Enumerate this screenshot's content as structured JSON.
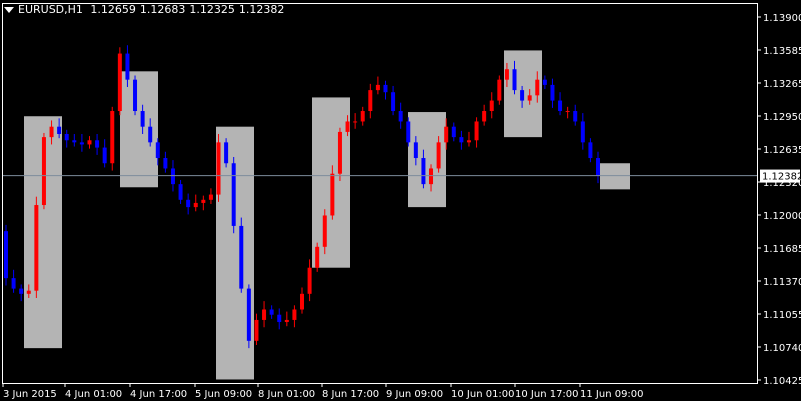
{
  "header": {
    "symbol": "EURUSD,H1",
    "open": "1.12659",
    "high": "1.12683",
    "low": "1.12325",
    "close": "1.12382"
  },
  "current_price": "1.12382",
  "colors": {
    "background": "#000000",
    "bull": "#ff0000",
    "bear": "#0000ff",
    "box": "#b4b4b4",
    "axis": "#ffffff",
    "price_line": "#7d8c9c"
  },
  "chart_data": {
    "type": "candlestick",
    "title": "",
    "y_ticks": [
      "1.13900",
      "1.13585",
      "1.13265",
      "1.12950",
      "1.12635",
      "1.12320",
      "1.12000",
      "1.11685",
      "1.11370",
      "1.11055",
      "1.10740",
      "1.10425"
    ],
    "x_ticks": [
      "3 Jun 2015",
      "4 Jun 01:00",
      "4 Jun 17:00",
      "5 Jun 09:00",
      "8 Jun 01:00",
      "8 Jun 17:00",
      "9 Jun 09:00",
      "10 Jun 01:00",
      "10 Jun 17:00",
      "11 Jun 09:00"
    ],
    "ylim": [
      1.10425,
      1.139
    ],
    "boxes": [
      {
        "high": 1.1295,
        "low": 1.1073
      },
      {
        "high": 1.1338,
        "low": 1.1227
      },
      {
        "high": 1.1285,
        "low": 1.1043
      },
      {
        "high": 1.1313,
        "low": 1.115
      },
      {
        "high": 1.1299,
        "low": 1.1208
      },
      {
        "high": 1.1358,
        "low": 1.1275
      },
      {
        "high": 1.125,
        "low": 1.1225
      }
    ],
    "price_path": [
      1.1185,
      1.114,
      1.113,
      1.1125,
      1.1128,
      1.121,
      1.1275,
      1.1285,
      1.1278,
      1.1272,
      1.127,
      1.1268,
      1.1272,
      1.1265,
      1.125,
      1.13,
      1.1355,
      1.133,
      1.13,
      1.1285,
      1.127,
      1.1255,
      1.1245,
      1.123,
      1.1215,
      1.1208,
      1.1212,
      1.1215,
      1.122,
      1.127,
      1.125,
      1.119,
      1.113,
      1.108,
      1.11,
      1.111,
      1.1105,
      1.1098,
      1.11,
      1.111,
      1.1125,
      1.115,
      1.117,
      1.12,
      1.124,
      1.128,
      1.129,
      1.129,
      1.13,
      1.132,
      1.1325,
      1.1318,
      1.13,
      1.129,
      1.127,
      1.1255,
      1.123,
      1.1245,
      1.127,
      1.1285,
      1.1275,
      1.127,
      1.1272,
      1.129,
      1.13,
      1.131,
      1.133,
      1.134,
      1.132,
      1.131,
      1.1315,
      1.133,
      1.1325,
      1.131,
      1.13,
      1.13,
      1.129,
      1.127,
      1.1255,
      1.1238
    ]
  }
}
